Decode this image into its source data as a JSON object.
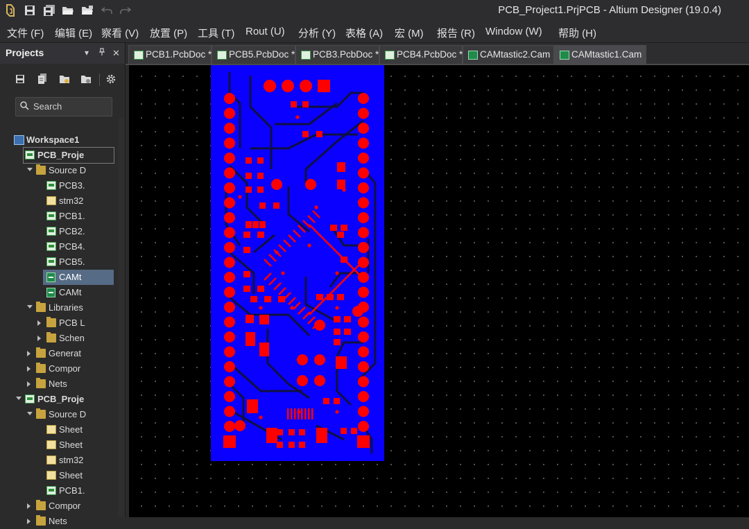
{
  "window": {
    "title": "PCB_Project1.PrjPCB - Altium Designer (19.0.4)"
  },
  "toolbar": {
    "icons": [
      "app-logo-icon",
      "save-icon",
      "save-all-icon",
      "open-icon",
      "open-project-icon",
      "undo-icon",
      "redo-icon"
    ]
  },
  "menu": {
    "items": [
      "文件 (F)",
      "编辑 (E)",
      "察看 (V)",
      "放置 (P)",
      "工具 (T)",
      "Rout (U)",
      "分析 (Y)",
      "表格 (A)",
      "宏 (M)",
      "报告 (R)",
      "Window (W)",
      "帮助 (H)"
    ]
  },
  "projects_panel": {
    "title": "Projects",
    "search_placeholder": "Search",
    "tree": [
      {
        "label": "Workspace1",
        "level": 0,
        "icon": "workspace",
        "arrow": "none",
        "bold": true
      },
      {
        "label": "PCB_Proje",
        "level": 1,
        "icon": "pcb",
        "arrow": "open",
        "bold": true,
        "outlined": true
      },
      {
        "label": "Source D",
        "level": 2,
        "icon": "folder",
        "arrow": "open"
      },
      {
        "label": "PCB3.",
        "level": 3,
        "icon": "pcb",
        "arrow": "none"
      },
      {
        "label": "stm32",
        "level": 3,
        "icon": "sch",
        "arrow": "none"
      },
      {
        "label": "PCB1.",
        "level": 3,
        "icon": "pcb",
        "arrow": "none"
      },
      {
        "label": "PCB2.",
        "level": 3,
        "icon": "pcb",
        "arrow": "none"
      },
      {
        "label": "PCB4.",
        "level": 3,
        "icon": "pcb",
        "arrow": "none"
      },
      {
        "label": "PCB5.",
        "level": 3,
        "icon": "pcb",
        "arrow": "none"
      },
      {
        "label": "CAMt",
        "level": 3,
        "icon": "cam",
        "arrow": "none",
        "selected": true
      },
      {
        "label": "CAMt",
        "level": 3,
        "icon": "cam",
        "arrow": "none"
      },
      {
        "label": "Libraries",
        "level": 2,
        "icon": "folder",
        "arrow": "open"
      },
      {
        "label": "PCB L",
        "level": 3,
        "icon": "folder",
        "arrow": "closed"
      },
      {
        "label": "Schen",
        "level": 3,
        "icon": "folder",
        "arrow": "closed"
      },
      {
        "label": "Generat",
        "level": 2,
        "icon": "folder",
        "arrow": "closed"
      },
      {
        "label": "Compor",
        "level": 2,
        "icon": "folder",
        "arrow": "closed"
      },
      {
        "label": "Nets",
        "level": 2,
        "icon": "folder",
        "arrow": "closed"
      },
      {
        "label": "PCB_Proje",
        "level": 1,
        "icon": "pcb",
        "arrow": "open",
        "bold": true
      },
      {
        "label": "Source D",
        "level": 2,
        "icon": "folder",
        "arrow": "open"
      },
      {
        "label": "Sheet",
        "level": 3,
        "icon": "sch",
        "arrow": "none"
      },
      {
        "label": "Sheet",
        "level": 3,
        "icon": "sch",
        "arrow": "none"
      },
      {
        "label": "stm32",
        "level": 3,
        "icon": "sch",
        "arrow": "none"
      },
      {
        "label": "Sheet",
        "level": 3,
        "icon": "sch",
        "arrow": "none"
      },
      {
        "label": "PCB1.",
        "level": 3,
        "icon": "pcb",
        "arrow": "none"
      },
      {
        "label": "Compor",
        "level": 2,
        "icon": "folder",
        "arrow": "closed"
      },
      {
        "label": "Nets",
        "level": 2,
        "icon": "folder",
        "arrow": "closed"
      }
    ]
  },
  "tabs": [
    {
      "label": "PCB1.PcbDoc *",
      "kind": "pcb"
    },
    {
      "label": "PCB5.PcbDoc *",
      "kind": "pcb"
    },
    {
      "label": "PCB3.PcbDoc *",
      "kind": "pcb"
    },
    {
      "label": "PCB4.PcbDoc *",
      "kind": "pcb"
    },
    {
      "label": "CAMtastic2.Cam",
      "kind": "cam"
    },
    {
      "label": "CAMtastic1.Cam",
      "kind": "cam",
      "active": true
    }
  ],
  "colors": {
    "board_fill": "#0a00ff",
    "copper_pads": "#ff0000",
    "traces": "#101040",
    "canvas_bg": "#000000"
  }
}
